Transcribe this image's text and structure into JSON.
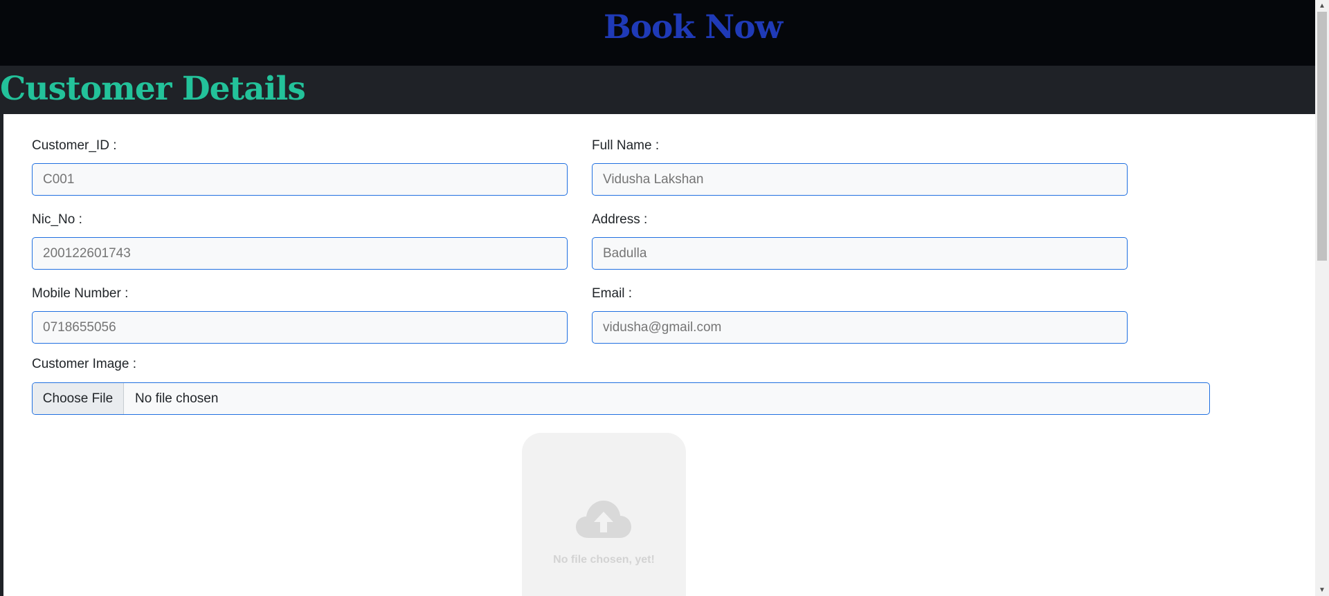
{
  "header": {
    "title": "Book Now"
  },
  "section": {
    "title": "Customer Details"
  },
  "form": {
    "customer_id": {
      "label": "Customer_ID :",
      "placeholder": "C001"
    },
    "full_name": {
      "label": "Full Name :",
      "placeholder": "Vidusha Lakshan"
    },
    "nic_no": {
      "label": "Nic_No :",
      "placeholder": "200122601743"
    },
    "address": {
      "label": "Address :",
      "placeholder": "Badulla"
    },
    "mobile": {
      "label": "Mobile Number :",
      "placeholder": "0718655056"
    },
    "email": {
      "label": "Email :",
      "placeholder": "vidusha@gmail.com"
    },
    "image": {
      "label": "Customer Image :",
      "button_label": "Choose File",
      "status": "No file chosen"
    }
  },
  "preview": {
    "text": "No file chosen, yet!",
    "icon": "cloud-upload-icon"
  },
  "colors": {
    "header_bg": "#05070b",
    "header_title": "#1f3ab7",
    "section_bg": "#1f2227",
    "section_title": "#23c29a",
    "input_border": "#1f6fe0"
  }
}
